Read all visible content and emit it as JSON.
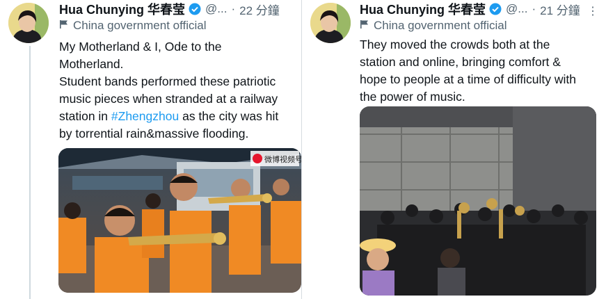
{
  "tweets": [
    {
      "author": {
        "name": "Hua Chunying 华春莹",
        "handle": "@...",
        "verified": true
      },
      "time": "22 分鐘",
      "label": "China government official",
      "text_lines": [
        "My Motherland & I, Ode to the",
        "Motherland.",
        "Student bands performed these patriotic",
        "music pieces when stranded at a railway"
      ],
      "line5_prefix": "station in ",
      "hashtag": "#Zhengzhou",
      "line5_suffix": " as the city was hit",
      "line6": "by torrential rain&massive flooding.",
      "media": {
        "watermark": "微博视频号"
      }
    },
    {
      "author": {
        "name": "Hua Chunying 华春莹",
        "handle": "@...",
        "verified": true
      },
      "time": "21 分鐘",
      "label": "China government official",
      "text_lines": [
        "They moved the crowds both at the",
        "station and  online, bringing comfort &",
        "hope to people at a time of difficulty with",
        "the power of music."
      ]
    }
  ],
  "icons": [
    "verified-badge-icon",
    "flag-icon",
    "more-options-icon"
  ],
  "colors": {
    "link": "#1d9bf0",
    "secondary": "#536471",
    "verified": "#1d9bf0",
    "shirt": "#f08a24"
  }
}
